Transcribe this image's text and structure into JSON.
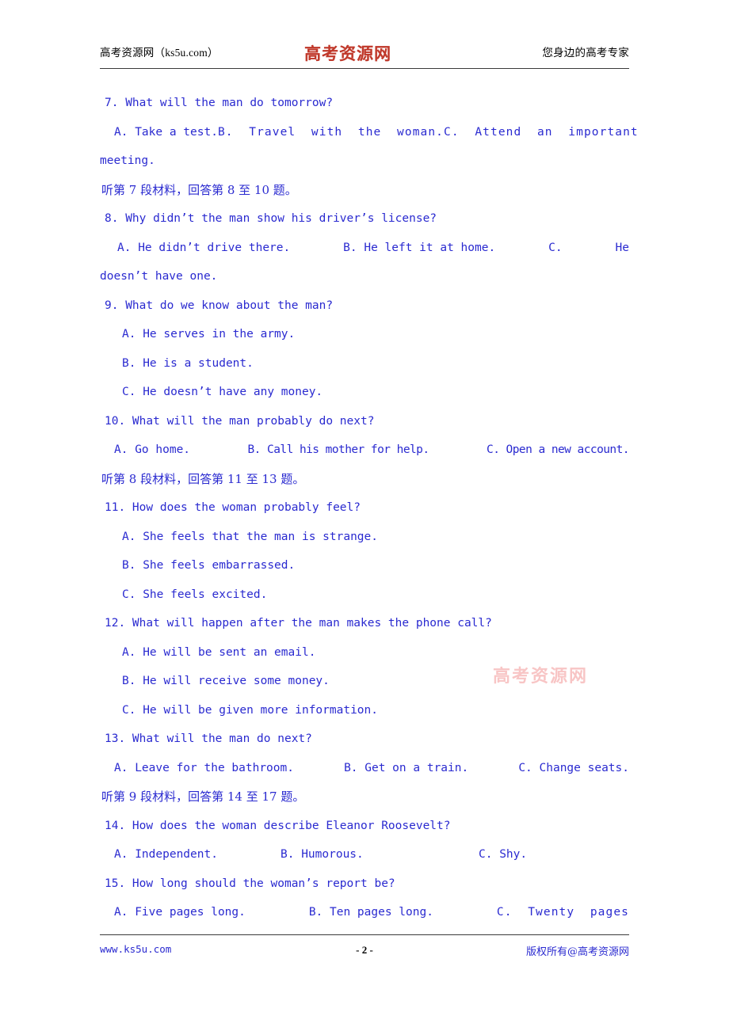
{
  "header": {
    "left": "高考资源网（ks5u.com）",
    "logo": "高考资源网",
    "right": "您身边的高考专家"
  },
  "watermark": "高考资源网",
  "footer": {
    "site": "www.ks5u.com",
    "page_number": "- 2 -",
    "copyright": "版权所有@高考资源网"
  },
  "content": {
    "q7": {
      "stem": "7. What will the man do tomorrow?",
      "a": "A. Take a test.",
      "b": "B.  Travel  with  the  woman.",
      "c": "C.  Attend  an  important",
      "wrap": "meeting."
    },
    "dir7": "听第 7 段材料，回答第 8 至 10 题。",
    "q8": {
      "stem": "8. Why didn’t the man show his driver’s license?",
      "a": "A. He didn’t drive there.",
      "b": "B. He left it at home.",
      "c": "C.",
      "c_tail": "He",
      "wrap": "doesn’t have one."
    },
    "q9": {
      "stem": "9. What do we know about the man?",
      "a": "A. He serves in the army.",
      "b": "B. He is a student.",
      "c": "C. He doesn’t have any money."
    },
    "q10": {
      "stem": "10. What will the man probably do next?",
      "a": "A. Go home.",
      "b": "B. Call his mother for help.",
      "c": "C. Open a new account."
    },
    "dir8": "听第 8 段材料，回答第 11 至 13 题。",
    "q11": {
      "stem": "11. How does the woman probably feel?",
      "a": "A. She feels that the man is strange.",
      "b": "B. She feels embarrassed.",
      "c": "C. She feels excited."
    },
    "q12": {
      "stem": "12. What will happen after the man makes the phone call?",
      "a": "A. He will be sent an email.",
      "b": "B. He will receive some money.",
      "c": "C. He will be given more information."
    },
    "q13": {
      "stem": "13. What will the man do next?",
      "a": "A. Leave for the bathroom.",
      "b": "B. Get on a train.",
      "c": "C. Change seats."
    },
    "dir9": "听第 9 段材料，回答第 14 至 17 题。",
    "q14": {
      "stem": "14. How does the woman describe Eleanor Roosevelt?",
      "a": "A. Independent.",
      "b": "B. Humorous.",
      "c": "C. Shy."
    },
    "q15": {
      "stem": "15. How long should the woman’s report be?",
      "a": "A. Five pages long.",
      "b": "B. Ten pages long.",
      "c": "C.  Twenty  pages"
    }
  },
  "colors": {
    "body_text": "#2a2ad0",
    "logo_red": "#c0392b",
    "watermark_pink": "#f7bcbc",
    "rule": "#3a3a3a"
  }
}
